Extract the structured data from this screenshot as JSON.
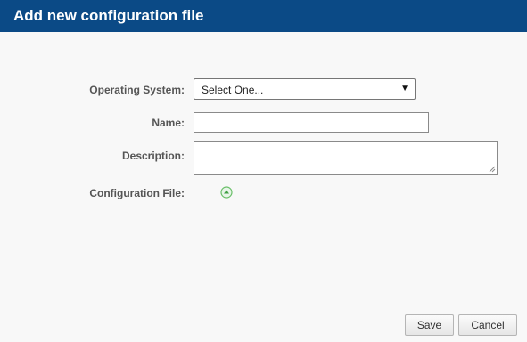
{
  "dialog": {
    "title": "Add new configuration file"
  },
  "form": {
    "os_label": "Operating System:",
    "os_selected": "Select One...",
    "name_label": "Name:",
    "name_value": "",
    "description_label": "Description:",
    "description_value": "",
    "config_file_label": "Configuration File:"
  },
  "icons": {
    "select_arrow": "dropdown-arrow-icon",
    "upload": "upload-icon",
    "resize": "resize-grip-icon"
  },
  "buttons": {
    "save": "Save",
    "cancel": "Cancel"
  },
  "colors": {
    "header_bg": "#0b4a86",
    "upload_icon": "#4caf50"
  }
}
